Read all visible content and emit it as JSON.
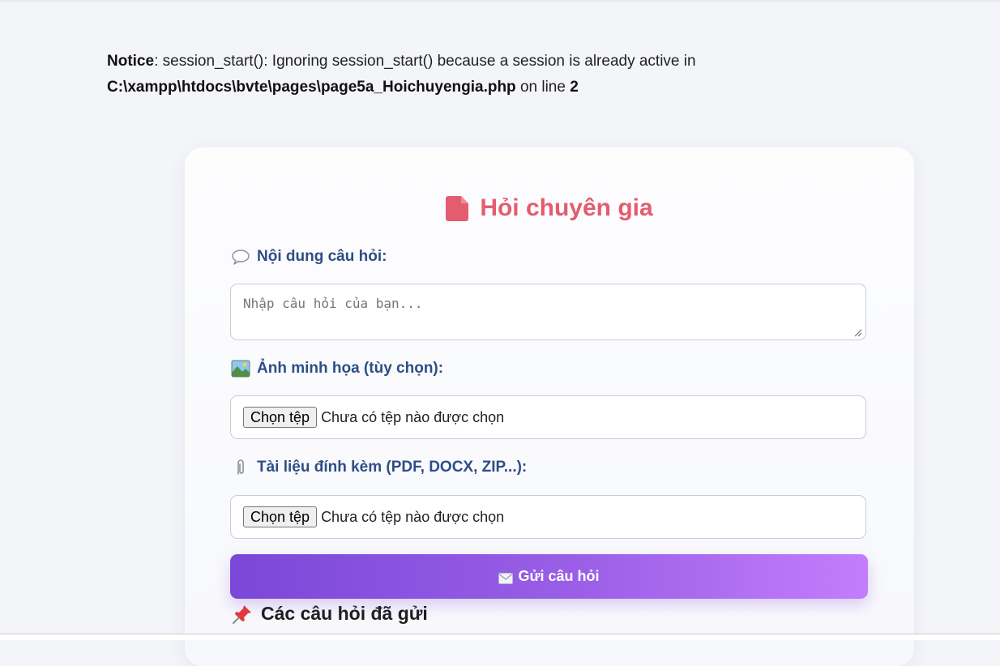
{
  "notice": {
    "label": "Notice",
    "message": ": session_start(): Ignoring session_start() because a session is already active in",
    "file_path": "C:\\xampp\\htdocs\\bvte\\pages\\page5a_Hoichuyengia.php",
    "on_line_text": " on line ",
    "line_number": "2"
  },
  "form": {
    "title": "Hỏi chuyên gia",
    "question_label": "Nội dung câu hỏi:",
    "question_placeholder": "Nhập câu hỏi của bạn...",
    "question_value": "",
    "image_label": "Ảnh minh họa (tùy chọn):",
    "image_button": "Chọn tệp",
    "image_status": "Chưa có tệp nào được chọn",
    "attachment_label": "Tài liệu đính kèm (PDF, DOCX, ZIP...):",
    "attachment_button": "Chọn tệp",
    "attachment_status": "Chưa có tệp nào được chọn",
    "submit_label": "Gửi câu hỏi"
  },
  "sent_section": {
    "heading": "Các câu hỏi đã gửi"
  },
  "icons": {
    "title": "document-icon",
    "question": "speech-bubble-icon",
    "image": "picture-icon",
    "attachment": "paperclip-icon",
    "submit": "envelope-icon",
    "sent": "pushpin-icon"
  },
  "colors": {
    "page_background": "#f4f5f9",
    "title": "#e35d6e",
    "label": "#2f4d86",
    "button_gradient_start": "#7b47d8",
    "button_gradient_end": "#c37dfc"
  }
}
